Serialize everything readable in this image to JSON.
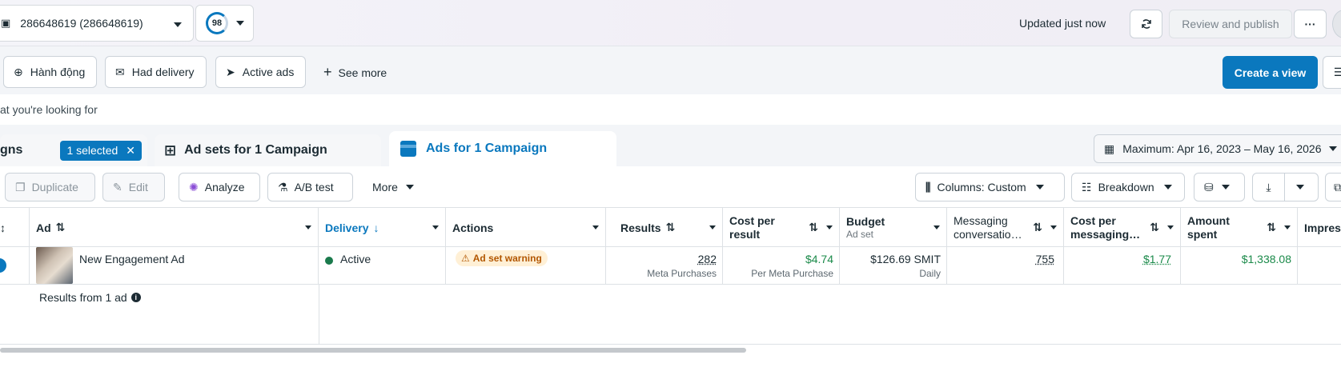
{
  "topbar": {
    "account": "286648619 (286648619)",
    "score": "98",
    "updated": "Updated just now",
    "review_publish": "Review and publish",
    "more": "···"
  },
  "filters": {
    "chips": [
      "Hành động",
      "Had delivery",
      "Active ads"
    ],
    "see_more": "See more",
    "create_view": "Create a view"
  },
  "search": {
    "placeholder": "at you're looking for"
  },
  "tabs": {
    "campaigns": "gns",
    "selected": "1 selected",
    "adsets": "Ad sets for 1 Campaign",
    "ads": "Ads for 1 Campaign",
    "date_range": "Maximum: Apr 16, 2023 – May 16, 2026"
  },
  "toolbar": {
    "duplicate": "Duplicate",
    "edit": "Edit",
    "analyze": "Analyze",
    "ab_test": "A/B test",
    "more": "More",
    "columns": "Columns: Custom",
    "breakdown": "Breakdown"
  },
  "columns": {
    "ad": "Ad",
    "delivery": "Delivery",
    "actions": "Actions",
    "results": "Results",
    "cost_per_result_1": "Cost per",
    "cost_per_result_2": "result",
    "budget": "Budget",
    "budget_sub": "Ad set",
    "messaging_1": "Messaging",
    "messaging_2": "conversatio…",
    "cost_msg_1": "Cost per",
    "cost_msg_2": "messaging…",
    "amount_1": "Amount",
    "amount_2": "spent",
    "impressions": "Impres"
  },
  "row": {
    "name": "New Engagement Ad",
    "delivery": "Active",
    "warning": "Ad set warning",
    "results": "282",
    "results_sub": "Meta Purchases",
    "cost_per_result": "$4.74",
    "cost_per_result_sub": "Per Meta Purchase",
    "budget": "$126.69 SMIT",
    "budget_sub": "Daily",
    "messaging": "755",
    "cost_msg": "$1.77",
    "amount": "$1,338.08"
  },
  "summary": {
    "label": "Results from 1 ad"
  },
  "colors": {
    "accent": "#0a78be",
    "positive": "#1b8a4a",
    "warning_bg": "#fff0d6",
    "status_active": "#1a7a4c"
  }
}
